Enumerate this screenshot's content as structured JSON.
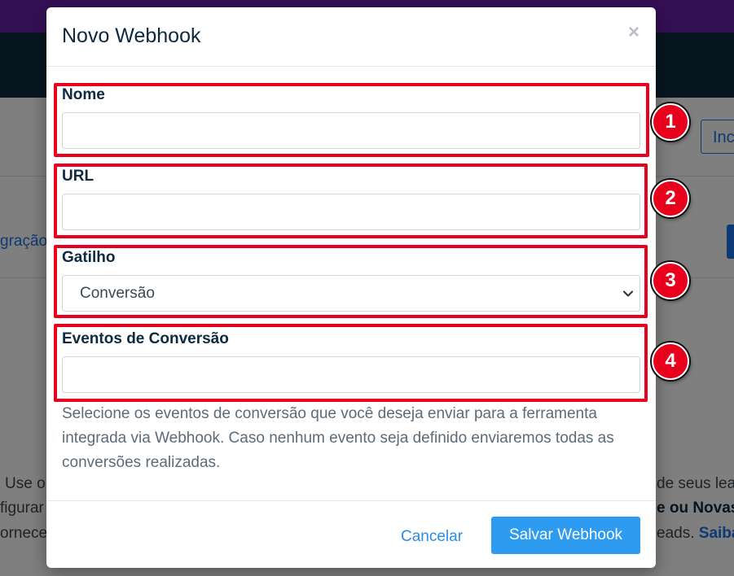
{
  "background": {
    "button_partial": "Inc",
    "tab_partial": "gração",
    "text_line1_left": "Use o",
    "text_line1_right": "de seus lea",
    "text_line2_left": "figurar",
    "text_line2_right": "e ou Novas",
    "text_line3_left": "ornece",
    "text_line3_right": "eads.",
    "text_line3_link": "Saiba"
  },
  "modal": {
    "title": "Novo Webhook",
    "close_symbol": "×",
    "fields": {
      "name": {
        "label": "Nome",
        "value": "",
        "placeholder": ""
      },
      "url": {
        "label": "URL",
        "value": "",
        "placeholder": ""
      },
      "trigger": {
        "label": "Gatilho",
        "selected": "Conversão"
      },
      "events": {
        "label": "Eventos de Conversão",
        "value": "",
        "placeholder": ""
      }
    },
    "help_text": "Selecione os eventos de conversão que você deseja enviar para a ferramenta integrada via Webhook. Caso nenhum evento seja definido enviaremos todas as conversões realizadas.",
    "footer": {
      "cancel_label": "Cancelar",
      "save_label": "Salvar Webhook"
    }
  },
  "annotations": [
    "1",
    "2",
    "3",
    "4"
  ],
  "colors": {
    "annotation": "#e8001c",
    "primary": "#2d9cf0",
    "link": "#2b8ce6",
    "heading": "#0e2a3f"
  }
}
